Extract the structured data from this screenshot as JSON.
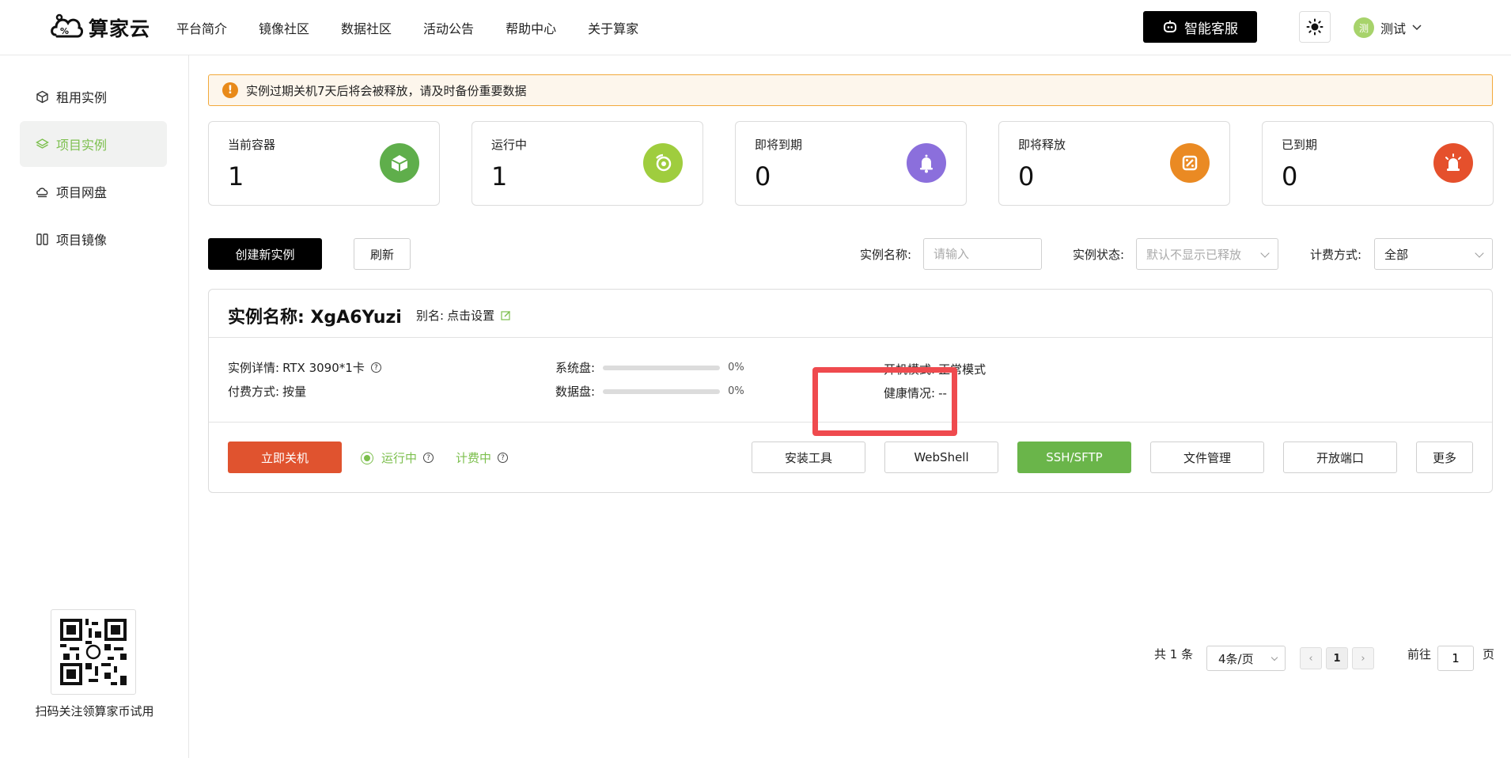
{
  "header": {
    "logo_text": "算家云",
    "nav": [
      "平台简介",
      "镜像社区",
      "数据社区",
      "活动公告",
      "帮助中心",
      "关于算家"
    ],
    "cs_button": "智能客服",
    "user_avatar": "测",
    "user_name": "测试"
  },
  "sidebar": {
    "items": [
      {
        "label": "租用实例",
        "icon": "cube-icon"
      },
      {
        "label": "项目实例",
        "icon": "layers-icon",
        "active": true
      },
      {
        "label": "项目网盘",
        "icon": "cloud-disk-icon"
      },
      {
        "label": "项目镜像",
        "icon": "image-icon"
      }
    ],
    "qr_caption": "扫码关注领算家币试用"
  },
  "notice": "实例过期关机7天后将会被释放，请及时备份重要数据",
  "stats": [
    {
      "label": "当前容器",
      "value": "1",
      "color": "#5fae4b",
      "icon": "container-icon"
    },
    {
      "label": "运行中",
      "value": "1",
      "color": "#9fcd3e",
      "icon": "timer-icon"
    },
    {
      "label": "即将到期",
      "value": "0",
      "color": "#8b6fdc",
      "icon": "bell-icon"
    },
    {
      "label": "即将释放",
      "value": "0",
      "color": "#ea8a23",
      "icon": "release-icon"
    },
    {
      "label": "已到期",
      "value": "0",
      "color": "#e5502c",
      "icon": "alarm-icon"
    }
  ],
  "toolbar": {
    "create_label": "创建新实例",
    "refresh_label": "刷新",
    "name_label": "实例名称:",
    "name_placeholder": "请输入",
    "status_label": "实例状态:",
    "status_value": "默认不显示已释放",
    "billing_label": "计费方式:",
    "billing_value": "全部"
  },
  "instance": {
    "title": "实例名称: XgA6Yuzi",
    "alias_label": "别名:",
    "alias_value": "点击设置",
    "detail_label": "实例详情:",
    "detail_value": "RTX 3090*1卡",
    "pay_label": "付费方式:",
    "pay_value": "按量",
    "sys_disk_label": "系统盘:",
    "sys_disk_pct": "0%",
    "data_disk_label": "数据盘:",
    "data_disk_pct": "0%",
    "boot_label": "开机模式:",
    "boot_value": "正常模式",
    "health_label": "健康情况:",
    "health_value": "--",
    "shutdown_label": "立即关机",
    "status_running": "运行中",
    "status_billing": "计费中",
    "actions": [
      "安装工具",
      "WebShell",
      "SSH/SFTP",
      "文件管理",
      "开放端口",
      "更多"
    ]
  },
  "pagination": {
    "total": "共 1 条",
    "page_size": "4条/页",
    "current": "1",
    "goto_label": "前往",
    "goto_value": "1",
    "page_unit": "页"
  }
}
